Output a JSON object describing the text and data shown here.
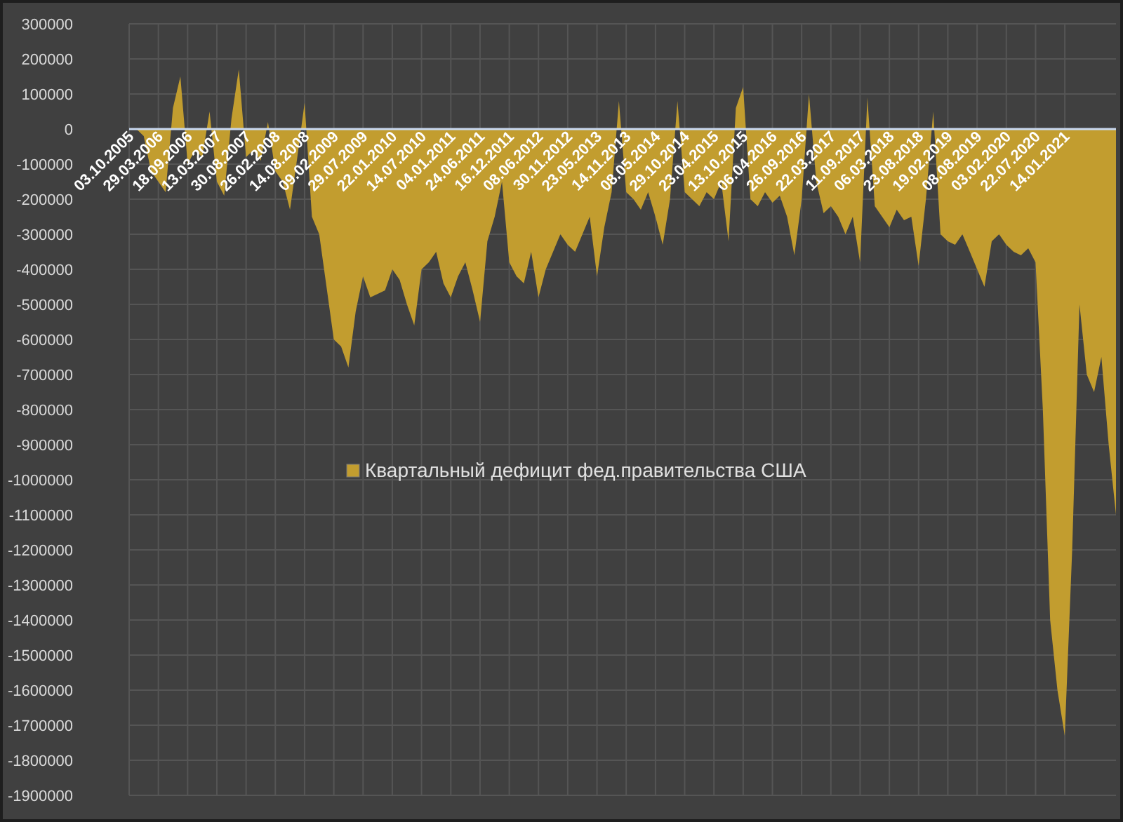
{
  "chart_data": {
    "type": "area",
    "grid": true,
    "ylim": [
      -1900000,
      300000
    ],
    "yticks": [
      300000,
      200000,
      100000,
      0,
      -100000,
      -200000,
      -300000,
      -400000,
      -500000,
      -600000,
      -700000,
      -800000,
      -900000,
      -1000000,
      -1100000,
      -1200000,
      -1300000,
      -1400000,
      -1500000,
      -1600000,
      -1700000,
      -1800000,
      -1900000
    ],
    "categories": [
      "03.10.2005",
      null,
      null,
      null,
      "29.03.2006",
      null,
      null,
      null,
      "18.09.2006",
      null,
      null,
      null,
      "13.03.2007",
      null,
      null,
      null,
      "30.08.2007",
      null,
      null,
      null,
      "26.02.2008",
      null,
      null,
      null,
      "14.08.2008",
      null,
      null,
      null,
      "09.02.2009",
      null,
      null,
      null,
      "29.07.2009",
      null,
      null,
      null,
      "22.01.2010",
      null,
      null,
      null,
      "14.07.2010",
      null,
      null,
      null,
      "04.01.2011",
      null,
      null,
      null,
      "24.06.2011",
      null,
      null,
      null,
      "16.12.2011",
      null,
      null,
      null,
      "08.06.2012",
      null,
      null,
      null,
      "30.11.2012",
      null,
      null,
      null,
      "23.05.2013",
      null,
      null,
      null,
      "14.11.2013",
      null,
      null,
      null,
      "08.05.2014",
      null,
      null,
      null,
      "29.10.2014",
      null,
      null,
      null,
      "23.04.2015",
      null,
      null,
      null,
      "13.10.2015",
      null,
      null,
      null,
      "06.04.2016",
      null,
      null,
      null,
      "26.09.2016",
      null,
      null,
      null,
      "22.03.2017",
      null,
      null,
      null,
      "11.09.2017",
      null,
      null,
      null,
      "06.03.2018",
      null,
      null,
      null,
      "23.08.2018",
      null,
      null,
      null,
      "19.02.2019",
      null,
      null,
      null,
      "08.08.2019",
      null,
      null,
      null,
      "03.02.2020",
      null,
      null,
      null,
      "22.07.2020",
      null,
      null,
      null,
      "14.01.2021",
      null,
      null,
      null,
      null,
      null,
      null,
      null
    ],
    "series": [
      {
        "name": "Квартальный дефицит фед.правительства США",
        "color": "#c29d2f",
        "values": [
          0,
          0,
          -20000,
          -120000,
          -150000,
          -180000,
          60000,
          150000,
          -100000,
          -60000,
          -80000,
          50000,
          -150000,
          -190000,
          30000,
          170000,
          -80000,
          -60000,
          -90000,
          20000,
          -120000,
          -150000,
          -230000,
          -80000,
          75000,
          -250000,
          -300000,
          -450000,
          -600000,
          -620000,
          -680000,
          -520000,
          -420000,
          -480000,
          -470000,
          -460000,
          -400000,
          -430000,
          -500000,
          -560000,
          -400000,
          -380000,
          -350000,
          -440000,
          -480000,
          -420000,
          -380000,
          -460000,
          -550000,
          -320000,
          -250000,
          -150000,
          -380000,
          -420000,
          -440000,
          -350000,
          -480000,
          -400000,
          -350000,
          -300000,
          -330000,
          -350000,
          -300000,
          -250000,
          -420000,
          -280000,
          -180000,
          80000,
          -180000,
          -200000,
          -230000,
          -180000,
          -250000,
          -330000,
          -200000,
          80000,
          -180000,
          -200000,
          -220000,
          -180000,
          -200000,
          -150000,
          -320000,
          60000,
          120000,
          -200000,
          -220000,
          -180000,
          -210000,
          -190000,
          -250000,
          -360000,
          -200000,
          100000,
          -150000,
          -240000,
          -220000,
          -250000,
          -300000,
          -250000,
          -380000,
          90000,
          -220000,
          -250000,
          -280000,
          -230000,
          -260000,
          -250000,
          -390000,
          -200000,
          50000,
          -300000,
          -320000,
          -330000,
          -300000,
          -350000,
          -400000,
          -450000,
          -320000,
          -300000,
          -330000,
          -350000,
          -360000,
          -340000,
          -380000,
          -800000,
          -1400000,
          -1600000,
          -1730000,
          -1200000,
          -500000,
          -700000,
          -750000,
          -650000,
          -900000,
          -1100000
        ]
      }
    ]
  }
}
